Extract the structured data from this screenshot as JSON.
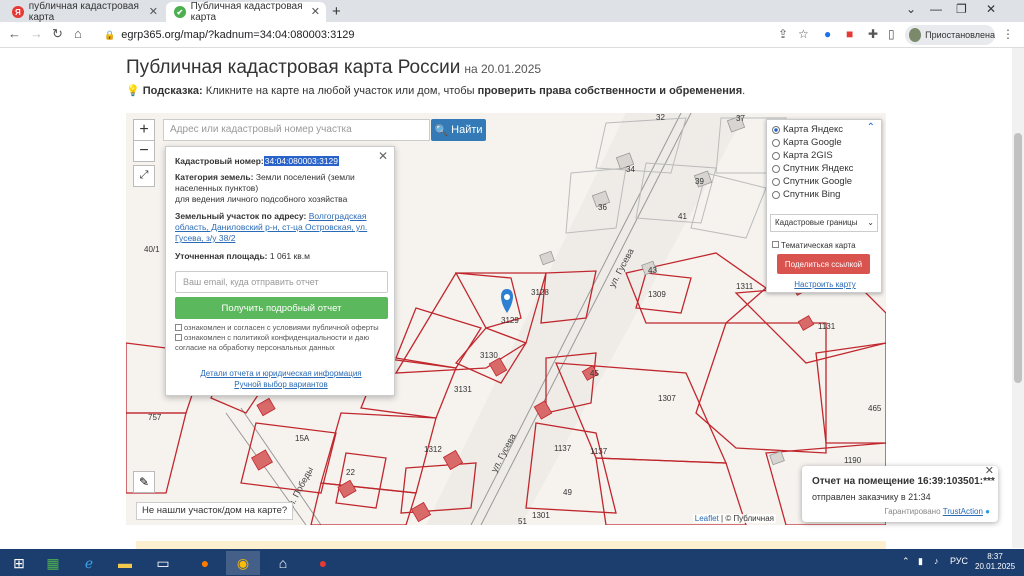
{
  "browser": {
    "tabs": [
      {
        "label": "публичная кадастровая карта",
        "favicon": "Я",
        "active": false
      },
      {
        "label": "Публичная кадастровая карта",
        "favicon": "✔",
        "active": true
      }
    ],
    "url": "egrp365.org/map/?kadnum=34:04:080003:3129",
    "profile_label": "Приостановлена"
  },
  "page": {
    "title": "Публичная кадастровая карта России",
    "title_date": "на 20.01.2025",
    "hint_label": "Подсказка:",
    "hint_text": "Кликните на карте на любой участок или дом, чтобы",
    "hint_bold": "проверить права собственности и обременения",
    "hint_end": "."
  },
  "map": {
    "search_placeholder": "Адрес или кадастровый номер участка",
    "search_button": "Найти",
    "zoom_in": "+",
    "zoom_out": "−",
    "not_found": "Не нашли участок/дом на карте?",
    "attribution_link": "Leaflet",
    "attribution_rest": "| © Публичная",
    "street1": "ул. Гусева",
    "street2": "ул. Гусева",
    "street3": "ул. Победы",
    "labels": [
      "32",
      "37",
      "34",
      "39",
      "36",
      "41",
      "40/1",
      "43",
      "1309",
      "3128",
      "3129",
      "3130",
      "1311",
      "1131",
      "45",
      "1307",
      "3131",
      "1312",
      "1137",
      "1137",
      "15A",
      "22",
      "757",
      "49",
      "51",
      "1301",
      "1190",
      "465"
    ]
  },
  "popup": {
    "cad_label": "Кадастровый номер:",
    "cad_value": "34:04:080003:3129",
    "cat_label": "Категория земель:",
    "cat_value": "Земли поселений (земли населенных пунктов)",
    "use_value": "для ведения личного подсобного хозяйства",
    "addr_label": "Земельный участок по адресу:",
    "addr_value": "Волгоградская область, Даниловский р-н, ст-ца Островская, ул. Гусева, з/у 38/2",
    "area_label": "Уточненная площадь:",
    "area_value": "1 061 кв.м",
    "email_placeholder": "Ваш email, куда отправить отчет",
    "get_report": "Получить подробный отчет",
    "agree1": "ознакомлен и согласен с условиями публичной оферты",
    "agree2": "ознакомлен с политикой конфиденциальности и даю согласие на обработку персональных данных",
    "link1": "Детали отчета и юридическая информация",
    "link2": "Ручной выбор вариантов"
  },
  "layers": {
    "options": [
      "Карта Яндекс",
      "Карта Google",
      "Карта 2GIS",
      "Спутник Яндекс",
      "Спутник Google",
      "Спутник Bing"
    ],
    "selected": "Карта Яндекс",
    "select_value": "Кадастровые границы",
    "thematic": "Тематическая карта",
    "share_button": "Поделиться ссылкой",
    "configure": "Настроить карту"
  },
  "toast": {
    "title": "Отчет на помещение 16:39:103501:***",
    "subtitle": "отправлен заказчику в 21:34",
    "guarantee": "Гарантировано",
    "trust": "TrustAction"
  },
  "taskbar": {
    "lang": "РУС",
    "time": "8:37",
    "date": "20.01.2025"
  }
}
